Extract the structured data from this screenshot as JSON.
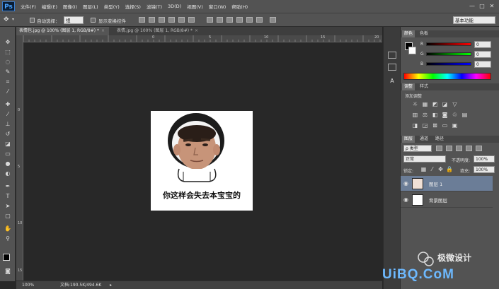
{
  "app": {
    "logo": "Ps",
    "menus": [
      "文件(F)",
      "编辑(E)",
      "图像(I)",
      "图层(L)",
      "类型(Y)",
      "选择(S)",
      "滤镜(T)",
      "3D(D)",
      "视图(V)",
      "窗口(W)",
      "帮助(H)"
    ],
    "window_controls": [
      "—",
      "□",
      "✕"
    ]
  },
  "options": {
    "auto_select_label": "自动选择：",
    "auto_select_value": "组",
    "show_transform_label": "显示变换控件",
    "workspace": "基本功能"
  },
  "tabs": [
    {
      "label": "表情包.jpg @ 100% (图层 1, RGB/8#) *",
      "active": true
    },
    {
      "label": "表情.jpg @ 100% (图层 1, RGB/8#) *",
      "active": false
    }
  ],
  "rulers": {
    "top": [
      "0",
      "5",
      "10",
      "15",
      "20"
    ],
    "left": [
      "0",
      "5",
      "10",
      "15"
    ]
  },
  "canvas": {
    "caption": "你这样会失去本宝宝的"
  },
  "status": {
    "zoom": "100%",
    "doc": "文档:190.5K/494.6K"
  },
  "color_panel": {
    "tabs": [
      "颜色",
      "色板"
    ],
    "channels": [
      {
        "label": "R",
        "value": "0"
      },
      {
        "label": "G",
        "value": "0"
      },
      {
        "label": "B",
        "value": "0"
      }
    ]
  },
  "adjust_panel": {
    "tabs": [
      "调整",
      "样式"
    ],
    "title": "添加调整"
  },
  "layers_panel": {
    "tabs": [
      "图层",
      "通道",
      "路径"
    ],
    "filter": "ρ 类型",
    "blend_mode": "正常",
    "opacity_label": "不透明度:",
    "opacity_value": "100%",
    "lock_label": "锁定:",
    "fill_label": "填充:",
    "fill_value": "100%",
    "layers": [
      {
        "name": "图层 1",
        "selected": true
      },
      {
        "name": "背景图层",
        "selected": false
      }
    ]
  },
  "watermark": {
    "brand": "极微设计",
    "site": "UiBQ.CoM"
  },
  "colors": {
    "accent_blue": "#3b7ecf",
    "selected_layer": "#6b7d97"
  }
}
